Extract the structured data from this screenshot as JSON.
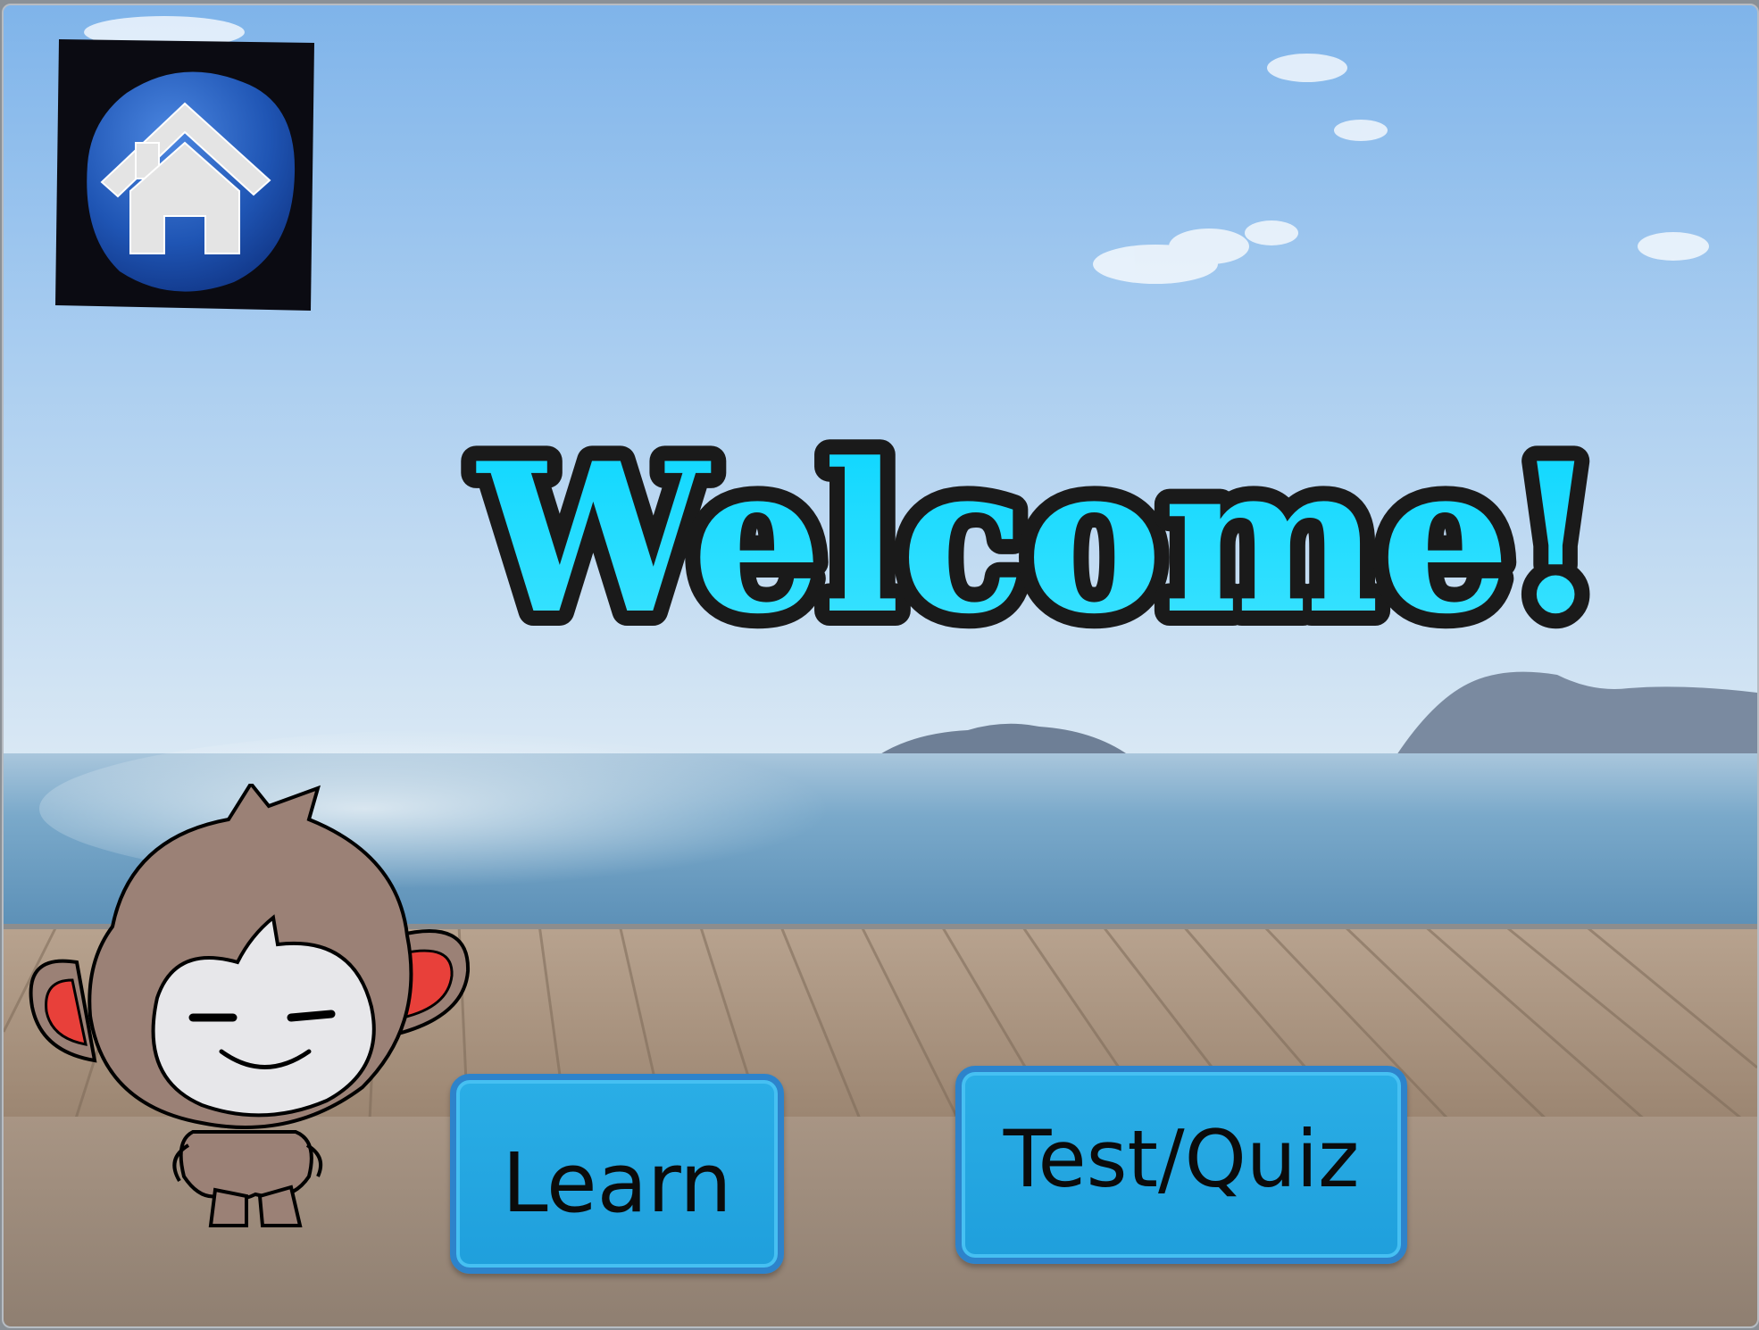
{
  "app": {
    "title": "Welcome!",
    "home_icon": "home-icon",
    "mascot": "monkey-character"
  },
  "buttons": {
    "learn_label": "Learn",
    "test_label": "Test/Quiz"
  },
  "colors": {
    "title_fill": "#19dcff",
    "title_outline": "#111111",
    "button_fill": "#27a8e2",
    "button_border": "#2d83cb",
    "home_bg": "#0b0b12",
    "home_badge": "#1d4fa8"
  }
}
